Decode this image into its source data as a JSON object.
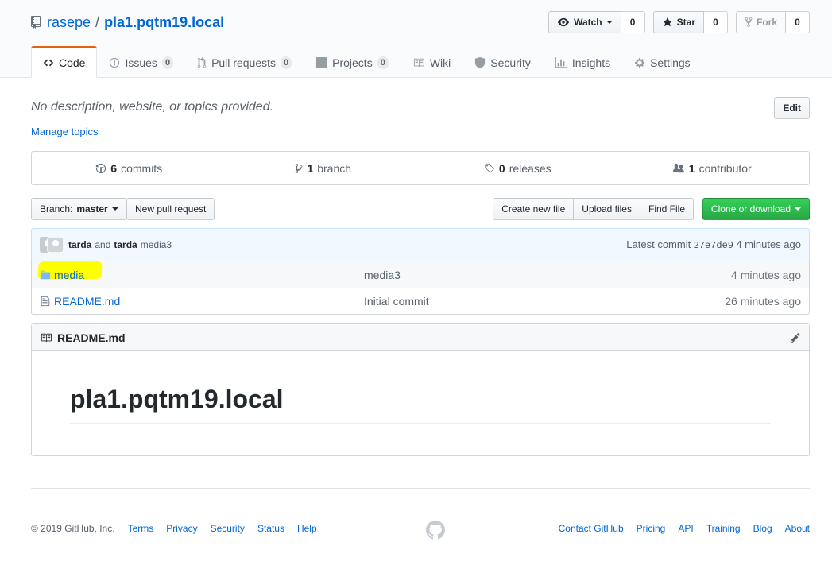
{
  "repo": {
    "owner": "rasepe",
    "separator": "/",
    "name": "pla1.pqtm19.local"
  },
  "actions": {
    "watch_label": "Watch",
    "watch_count": "0",
    "star_label": "Star",
    "star_count": "0",
    "fork_label": "Fork",
    "fork_count": "0"
  },
  "tabs": [
    {
      "label": "Code",
      "icon": "code-icon",
      "count": ""
    },
    {
      "label": "Issues",
      "icon": "issue-icon",
      "count": "0"
    },
    {
      "label": "Pull requests",
      "icon": "pull-request-icon",
      "count": "0"
    },
    {
      "label": "Projects",
      "icon": "project-icon",
      "count": "0"
    },
    {
      "label": "Wiki",
      "icon": "book-icon",
      "count": ""
    },
    {
      "label": "Security",
      "icon": "shield-icon",
      "count": ""
    },
    {
      "label": "Insights",
      "icon": "graph-icon",
      "count": ""
    },
    {
      "label": "Settings",
      "icon": "gear-icon",
      "count": ""
    }
  ],
  "description": "No description, website, or topics provided.",
  "manage_topics": "Manage topics",
  "edit_label": "Edit",
  "summary": {
    "commits_num": "6",
    "commits_label": "commits",
    "branch_num": "1",
    "branch_label": "branch",
    "releases_num": "0",
    "releases_label": "releases",
    "contributor_num": "1",
    "contributor_label": "contributor"
  },
  "filebar": {
    "branch_prefix": "Branch:",
    "branch_name": "master",
    "new_pr": "New pull request",
    "create_file": "Create new file",
    "upload_files": "Upload files",
    "find_file": "Find File",
    "clone": "Clone or download"
  },
  "commit": {
    "author1": "tarda",
    "and": "and",
    "author2": "tarda",
    "message": "media3",
    "latest_label": "Latest commit",
    "sha": "27e7de9",
    "age": "4 minutes ago"
  },
  "files": [
    {
      "name": "media",
      "type": "folder",
      "message": "media3",
      "age": "4 minutes ago"
    },
    {
      "name": "README.md",
      "type": "file",
      "message": "Initial commit",
      "age": "26 minutes ago"
    }
  ],
  "readme": {
    "filename": "README.md",
    "heading": "pla1.pqtm19.local"
  },
  "footer": {
    "copyright": "© 2019 GitHub, Inc.",
    "left_links": [
      "Terms",
      "Privacy",
      "Security",
      "Status",
      "Help"
    ],
    "right_links": [
      "Contact GitHub",
      "Pricing",
      "API",
      "Training",
      "Blog",
      "About"
    ]
  },
  "colors": {
    "accent": "#0366d6",
    "tab_active": "#e36209",
    "green": "#28a745",
    "highlight": "#ffff00"
  }
}
